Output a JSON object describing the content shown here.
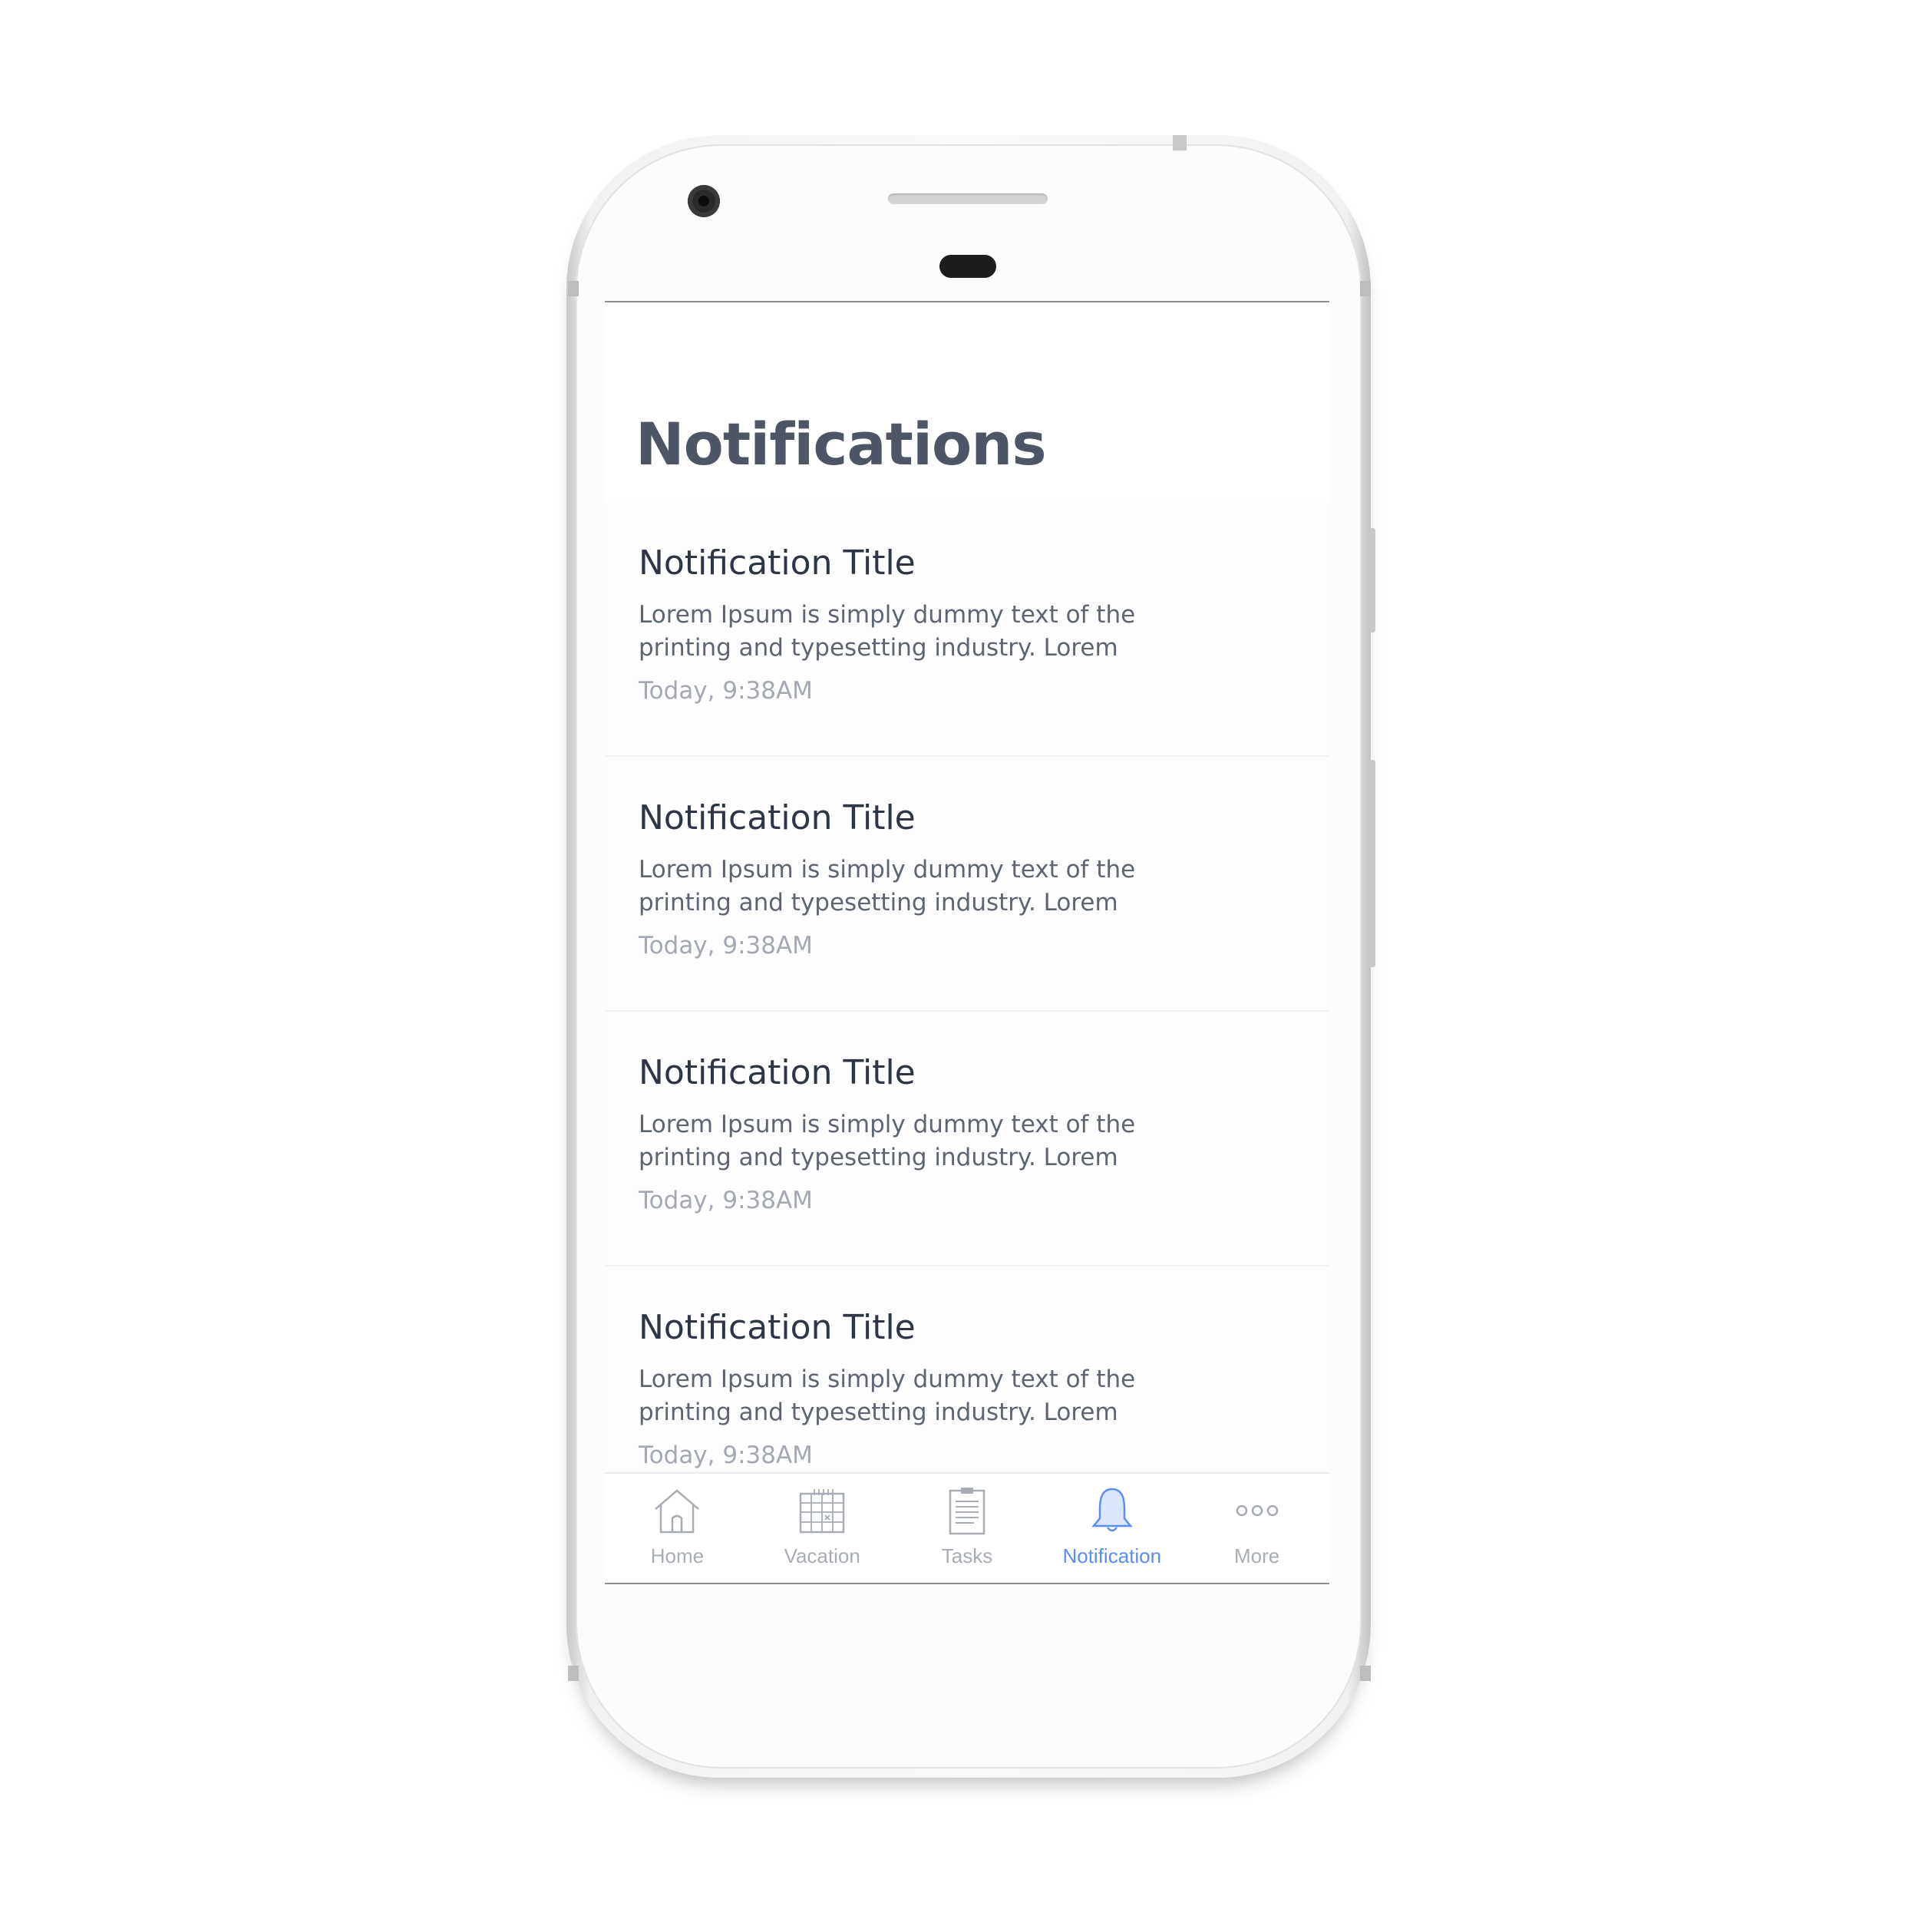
{
  "screen": {
    "title": "Notifications"
  },
  "notifications": [
    {
      "title": "Notification Title",
      "body": "Lorem Ipsum is simply dummy text of the printing and typesetting industry. Lorem",
      "time": "Today, 9:38AM"
    },
    {
      "title": "Notification Title",
      "body": "Lorem Ipsum is simply dummy text of the printing and typesetting industry. Lorem",
      "time": "Today, 9:38AM"
    },
    {
      "title": "Notification Title",
      "body": "Lorem Ipsum is simply dummy text of the printing and typesetting industry. Lorem",
      "time": "Today, 9:38AM"
    },
    {
      "title": "Notification Title",
      "body": "Lorem Ipsum is simply dummy text of the printing and typesetting industry. Lorem",
      "time": "Today, 9:38AM"
    }
  ],
  "tabbar": {
    "tabs": [
      {
        "label": "Home",
        "icon": "home-icon",
        "active": false
      },
      {
        "label": "Vacation",
        "icon": "calendar-icon",
        "active": false
      },
      {
        "label": "Tasks",
        "icon": "clipboard-icon",
        "active": false
      },
      {
        "label": "Notification",
        "icon": "bell-icon",
        "active": true
      },
      {
        "label": "More",
        "icon": "more-dots-icon",
        "active": false
      }
    ]
  },
  "colors": {
    "accent": "#5b8ef0",
    "title_text": "#4e5665",
    "item_title": "#2e3544",
    "body_text": "#5d6472",
    "time_text": "#a3a8b2",
    "inactive_tab": "#a8adb5"
  }
}
